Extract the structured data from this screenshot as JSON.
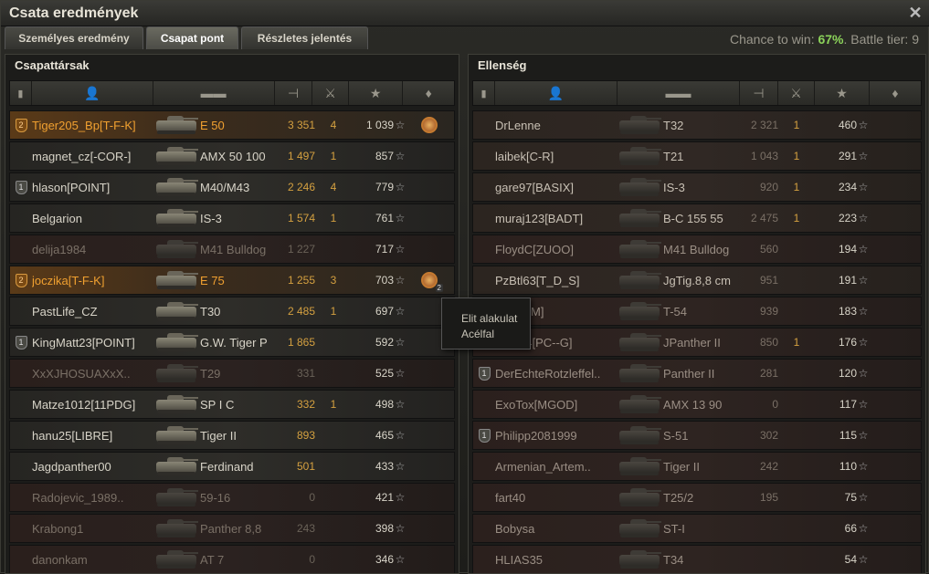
{
  "window": {
    "title": "Csata eredmények",
    "close_icon": "close-icon"
  },
  "tabs": [
    {
      "label": "Személyes eredmény"
    },
    {
      "label": "Csapat pont"
    },
    {
      "label": "Részletes jelentés"
    }
  ],
  "chance": {
    "prefix": "Chance to win: ",
    "value": "67%",
    "suffix": ". Battle tier: 9"
  },
  "left_panel": {
    "title": "Csapattársak",
    "rows": [
      {
        "squad": "2",
        "name": "Tiger205_Bp[T-F-K]",
        "vehicle": "E 50",
        "damage": "3 351",
        "kills": "4",
        "xp": "1 039",
        "medal": true
      },
      {
        "squad": "",
        "name": "magnet_cz[-COR-]",
        "vehicle": "AMX 50 100",
        "damage": "1 497",
        "kills": "1",
        "xp": "857"
      },
      {
        "squad": "1",
        "name": "hlason[POINT]",
        "vehicle": "M40/M43",
        "damage": "2 246",
        "kills": "4",
        "xp": "779"
      },
      {
        "squad": "",
        "name": "Belgarion",
        "vehicle": "IS-3",
        "damage": "1 574",
        "kills": "1",
        "xp": "761"
      },
      {
        "squad": "",
        "name": "delija1984",
        "vehicle": "M41 Bulldog",
        "damage": "1 227",
        "kills": "",
        "xp": "717"
      },
      {
        "squad": "2",
        "name": "joczika[T-F-K]",
        "vehicle": "E 75",
        "damage": "1 255",
        "kills": "3",
        "xp": "703",
        "medal": true,
        "medal_count": "2"
      },
      {
        "squad": "",
        "name": "PastLife_CZ",
        "vehicle": "T30",
        "damage": "2 485",
        "kills": "1",
        "xp": "697"
      },
      {
        "squad": "1",
        "name": "KingMatt23[POINT]",
        "vehicle": "G.W. Tiger P",
        "damage": "1 865",
        "kills": "",
        "xp": "592"
      },
      {
        "squad": "",
        "name": "XxXJHOSUAXxX..",
        "vehicle": "T29",
        "damage": "331",
        "kills": "",
        "xp": "525"
      },
      {
        "squad": "",
        "name": "Matze1012[11PDG]",
        "vehicle": "SP I C",
        "damage": "332",
        "kills": "1",
        "xp": "498"
      },
      {
        "squad": "",
        "name": "hanu25[LIBRE]",
        "vehicle": "Tiger II",
        "damage": "893",
        "kills": "",
        "xp": "465"
      },
      {
        "squad": "",
        "name": "Jagdpanther00",
        "vehicle": "Ferdinand",
        "damage": "501",
        "kills": "",
        "xp": "433"
      },
      {
        "squad": "",
        "name": "Radojevic_1989..",
        "vehicle": "59-16",
        "damage": "0",
        "kills": "",
        "xp": "421"
      },
      {
        "squad": "",
        "name": "Krabong1",
        "vehicle": "Panther 8,8",
        "damage": "243",
        "kills": "",
        "xp": "398"
      },
      {
        "squad": "",
        "name": "danonkam",
        "vehicle": "AT 7",
        "damage": "0",
        "kills": "",
        "xp": "346"
      }
    ]
  },
  "right_panel": {
    "title": "Ellenség",
    "rows": [
      {
        "squad": "",
        "name": "DrLenne",
        "vehicle": "T32",
        "damage": "2 321",
        "kills": "1",
        "xp": "460"
      },
      {
        "squad": "",
        "name": "laibek[C-R]",
        "vehicle": "T21",
        "damage": "1 043",
        "kills": "1",
        "xp": "291"
      },
      {
        "squad": "",
        "name": "gare97[BASIX]",
        "vehicle": "IS-3",
        "damage": "920",
        "kills": "1",
        "xp": "234"
      },
      {
        "squad": "",
        "name": "muraj123[BADT]",
        "vehicle": "B-C 155 55",
        "damage": "2 475",
        "kills": "1",
        "xp": "223"
      },
      {
        "squad": "",
        "name": "FloydC[ZUOO]",
        "vehicle": "M41 Bulldog",
        "damage": "560",
        "kills": "",
        "xp": "194"
      },
      {
        "squad": "",
        "name": "PzBtl63[T_D_S]",
        "vehicle": "JgTig.8,8 cm",
        "damage": "951",
        "kills": "",
        "xp": "191"
      },
      {
        "squad": "",
        "name": "R[M-J-M]",
        "vehicle": "T-54",
        "damage": "939",
        "kills": "",
        "xp": "183"
      },
      {
        "squad": "",
        "name": "utter34[PC--G]",
        "vehicle": "JPanther II",
        "damage": "850",
        "kills": "1",
        "xp": "176"
      },
      {
        "squad": "1",
        "name": "DerEchteRotzleffel..",
        "vehicle": "Panther II",
        "damage": "281",
        "kills": "",
        "xp": "120"
      },
      {
        "squad": "",
        "name": "ExoTox[MGOD]",
        "vehicle": "AMX 13 90",
        "damage": "0",
        "kills": "",
        "xp": "117"
      },
      {
        "squad": "1",
        "name": "Philipp2081999",
        "vehicle": "S-51",
        "damage": "302",
        "kills": "",
        "xp": "115"
      },
      {
        "squad": "",
        "name": "Armenian_Artem..",
        "vehicle": "Tiger II",
        "damage": "242",
        "kills": "",
        "xp": "110"
      },
      {
        "squad": "",
        "name": "fart40",
        "vehicle": "T25/2",
        "damage": "195",
        "kills": "",
        "xp": "75"
      },
      {
        "squad": "",
        "name": "Bobysa",
        "vehicle": "ST-I",
        "damage": "",
        "kills": "",
        "xp": "66"
      },
      {
        "squad": "",
        "name": "HLIAS35",
        "vehicle": "T34",
        "damage": "",
        "kills": "",
        "xp": "54"
      }
    ]
  },
  "tooltip": {
    "line1": "Elit alakulat",
    "line2": "Acélfal"
  },
  "colors": {
    "accent": "#f0a030",
    "chance_value": "#8bd25a"
  }
}
